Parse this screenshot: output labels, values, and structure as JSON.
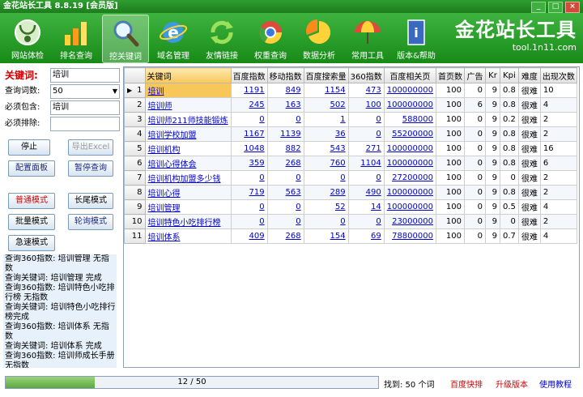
{
  "window": {
    "title": "金花站长工具 8.8.19 [会员版]",
    "minimize": "_",
    "maximize": "□",
    "close": "×"
  },
  "toolbar": {
    "items": [
      {
        "label": "网站体检",
        "icon": "stethoscope-icon",
        "active": false
      },
      {
        "label": "排名查询",
        "icon": "bar-chart-icon",
        "active": false
      },
      {
        "label": "挖关键词",
        "icon": "magnifier-icon",
        "active": true
      },
      {
        "label": "域名管理",
        "icon": "ie-globe-icon",
        "active": false
      },
      {
        "label": "友情链接",
        "icon": "refresh-arrows-icon",
        "active": false
      },
      {
        "label": "权重查询",
        "icon": "chrome-icon",
        "active": false
      },
      {
        "label": "数据分析",
        "icon": "pie-chart-icon",
        "active": false
      },
      {
        "label": "常用工具",
        "icon": "umbrella-icon",
        "active": false
      },
      {
        "label": "版本&帮助",
        "icon": "book-icon",
        "active": false
      }
    ],
    "brand": {
      "name": "金花站长工具",
      "url": "tool.1n11.com"
    }
  },
  "form": {
    "keyword_label": "关键词:",
    "keyword_value": "培训",
    "count_label": "查询词数:",
    "count_value": "50",
    "must_include_label": "必须包含:",
    "must_include_value": "培训",
    "must_exclude_label": "必须排除:",
    "must_exclude_value": ""
  },
  "buttons": {
    "stop": "停止",
    "export": "导出Excel",
    "config": "配置面板",
    "pause": "暂停查询",
    "normal_mode": "普通模式",
    "long_tail_mode": "长尾模式",
    "batch_mode": "批量模式",
    "poll_mode": "轮询模式",
    "fast_mode": "急速模式"
  },
  "log": [
    "查询360指数: 培训管理 无指数",
    "查询关键词: 培训管理 完成",
    "查询360指数: 培训特色小吃排行榜 无指数",
    "查询关键词: 培训特色小吃排行榜完成",
    "查询360指数: 培训体系 无指数",
    "查询关键词: 培训体系 完成",
    "查询360指数: 培训师成长手册 无指数"
  ],
  "table": {
    "headers": [
      "",
      "关键词",
      "百度指数",
      "移动指数",
      "百度搜索量",
      "360指数",
      "百度相关页",
      "首页数",
      "广告",
      "Kr",
      "Kpi",
      "难度",
      "出现次数"
    ],
    "rows": [
      {
        "n": "1",
        "kw": "培训",
        "bd": "1191",
        "mob": "849",
        "vol": "1154",
        "s360": "473",
        "pages": "100000000",
        "home": "100",
        "ad": "0",
        "kr": "9",
        "kpi": "0.8",
        "diff": "很难",
        "occ": "10"
      },
      {
        "n": "2",
        "kw": "培训师",
        "bd": "245",
        "mob": "163",
        "vol": "502",
        "s360": "100",
        "pages": "100000000",
        "home": "100",
        "ad": "6",
        "kr": "9",
        "kpi": "0.8",
        "diff": "很难",
        "occ": "4"
      },
      {
        "n": "3",
        "kw": "培训师211师技能锻炼",
        "bd": "0",
        "mob": "0",
        "vol": "1",
        "s360": "0",
        "pages": "588000",
        "home": "100",
        "ad": "0",
        "kr": "9",
        "kpi": "0.2",
        "diff": "很难",
        "occ": "2"
      },
      {
        "n": "4",
        "kw": "培训学校加盟",
        "bd": "1167",
        "mob": "1139",
        "vol": "36",
        "s360": "0",
        "pages": "55200000",
        "home": "100",
        "ad": "0",
        "kr": "9",
        "kpi": "0.8",
        "diff": "很难",
        "occ": "2"
      },
      {
        "n": "5",
        "kw": "培训机构",
        "bd": "1048",
        "mob": "882",
        "vol": "543",
        "s360": "271",
        "pages": "100000000",
        "home": "100",
        "ad": "0",
        "kr": "9",
        "kpi": "0.8",
        "diff": "很难",
        "occ": "16"
      },
      {
        "n": "6",
        "kw": "培训心得体会",
        "bd": "359",
        "mob": "268",
        "vol": "760",
        "s360": "1104",
        "pages": "100000000",
        "home": "100",
        "ad": "0",
        "kr": "9",
        "kpi": "0.8",
        "diff": "很难",
        "occ": "6"
      },
      {
        "n": "7",
        "kw": "培训机构加盟多少钱",
        "bd": "0",
        "mob": "0",
        "vol": "0",
        "s360": "0",
        "pages": "27200000",
        "home": "100",
        "ad": "0",
        "kr": "9",
        "kpi": "0",
        "diff": "很难",
        "occ": "2"
      },
      {
        "n": "8",
        "kw": "培训心得",
        "bd": "719",
        "mob": "563",
        "vol": "289",
        "s360": "490",
        "pages": "100000000",
        "home": "100",
        "ad": "0",
        "kr": "9",
        "kpi": "0.8",
        "diff": "很难",
        "occ": "2"
      },
      {
        "n": "9",
        "kw": "培训管理",
        "bd": "0",
        "mob": "0",
        "vol": "52",
        "s360": "14",
        "pages": "100000000",
        "home": "100",
        "ad": "0",
        "kr": "9",
        "kpi": "0.5",
        "diff": "很难",
        "occ": "4"
      },
      {
        "n": "10",
        "kw": "培训特色小吃排行榜",
        "bd": "0",
        "mob": "0",
        "vol": "0",
        "s360": "0",
        "pages": "23000000",
        "home": "100",
        "ad": "0",
        "kr": "9",
        "kpi": "0",
        "diff": "很难",
        "occ": "2"
      },
      {
        "n": "11",
        "kw": "培训体系",
        "bd": "409",
        "mob": "268",
        "vol": "154",
        "s360": "69",
        "pages": "78800000",
        "home": "100",
        "ad": "0",
        "kr": "9",
        "kpi": "0.7",
        "diff": "很难",
        "occ": "4"
      }
    ]
  },
  "status": {
    "progress_text": "12 / 50",
    "progress_fraction": 0.24,
    "found_text": "找到: 50 个词",
    "baidu_quick": "百度快排",
    "upgrade": "升级版本",
    "tutorial": "使用教程"
  }
}
